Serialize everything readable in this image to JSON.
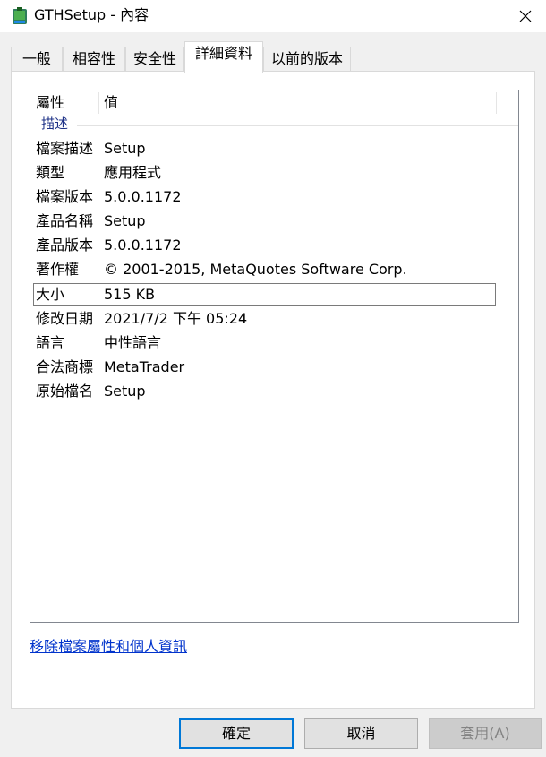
{
  "window": {
    "title": "GTHSetup - 內容",
    "close_glyph": "✕"
  },
  "tabs": [
    {
      "label": "一般",
      "active": false
    },
    {
      "label": "相容性",
      "active": false
    },
    {
      "label": "安全性",
      "active": false
    },
    {
      "label": "詳細資料",
      "active": true
    },
    {
      "label": "以前的版本",
      "active": false
    }
  ],
  "details": {
    "columns": {
      "property": "屬性",
      "value": "值"
    },
    "group_label": "描述",
    "rows": [
      {
        "name": "檔案描述",
        "value": "Setup"
      },
      {
        "name": "類型",
        "value": "應用程式"
      },
      {
        "name": "檔案版本",
        "value": "5.0.0.1172"
      },
      {
        "name": "產品名稱",
        "value": "Setup"
      },
      {
        "name": "產品版本",
        "value": "5.0.0.1172"
      },
      {
        "name": "著作權",
        "value": "© 2001-2015, MetaQuotes Software Corp."
      },
      {
        "name": "大小",
        "value": "515 KB",
        "selected": true
      },
      {
        "name": "修改日期",
        "value": "2021/7/2 下午 05:24"
      },
      {
        "name": "語言",
        "value": "中性語言"
      },
      {
        "name": "合法商標",
        "value": "MetaTrader"
      },
      {
        "name": "原始檔名",
        "value": "Setup"
      }
    ]
  },
  "remove_properties_link": "移除檔案屬性和個人資訊",
  "buttons": {
    "ok": "確定",
    "cancel": "取消",
    "apply": "套用(A)"
  },
  "colors": {
    "group_label": "#1e3287",
    "link": "#0033cc",
    "default_button_border": "#0078d7"
  }
}
